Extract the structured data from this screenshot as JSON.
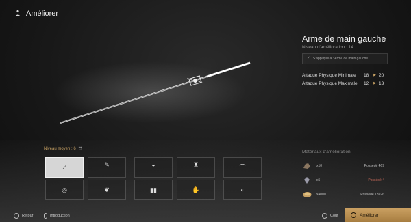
{
  "header": {
    "title": "Améliorer",
    "icon": "meditation-icon"
  },
  "weapon": {
    "name": "Arme de main gauche",
    "level_text": "Niveau d'amélioration : 14",
    "applies_to": "S'applique à : Arme de main gauche",
    "stats": [
      {
        "label": "Attaque Physique Minimale",
        "old": "18",
        "new": "20"
      },
      {
        "label": "Attaque Physique Maximale",
        "old": "12",
        "new": "13"
      }
    ]
  },
  "average_level": "Niveau moyen : 6",
  "slots": [
    {
      "name": "slot-weapon-main",
      "icon": "sword-icon",
      "glyph": "⟋",
      "selected": true
    },
    {
      "name": "slot-weapon-off",
      "icon": "dagger-icon",
      "glyph": "✎",
      "selected": false
    },
    {
      "name": "slot-armor-head",
      "icon": "helmet-icon",
      "glyph": "◒",
      "selected": false
    },
    {
      "name": "slot-armor-body",
      "icon": "chest-icon",
      "glyph": "♜",
      "selected": false
    },
    {
      "name": "slot-bow",
      "icon": "bow-icon",
      "glyph": "⌒",
      "selected": false
    },
    {
      "name": "slot-ring",
      "icon": "ring-icon",
      "glyph": "◎",
      "selected": false
    },
    {
      "name": "slot-pendant",
      "icon": "pendant-icon",
      "glyph": "❦",
      "selected": false
    },
    {
      "name": "slot-boots",
      "icon": "boots-icon",
      "glyph": "▮▮",
      "selected": false
    },
    {
      "name": "slot-gloves",
      "icon": "gloves-icon",
      "glyph": "✋",
      "selected": false
    },
    {
      "name": "slot-amulet",
      "icon": "amulet-icon",
      "glyph": "◐",
      "selected": false
    }
  ],
  "materials": {
    "title": "Matériaux d'amélioration",
    "items": [
      {
        "icon": "ore-icon",
        "qty": "x10",
        "owned": "Possédé 469",
        "low": false
      },
      {
        "icon": "crystal-icon",
        "qty": "x5",
        "owned": "Possédé 4",
        "low": true
      },
      {
        "icon": "coin-icon",
        "qty": "x4000",
        "owned": "Possédé 13926",
        "low": false
      }
    ]
  },
  "footer": {
    "back": "Retour",
    "intro": "Introduction",
    "cost": "Coût",
    "upgrade": "Améliorer"
  },
  "colors": {
    "accent": "#c9a264",
    "warning": "#c86a5a"
  }
}
